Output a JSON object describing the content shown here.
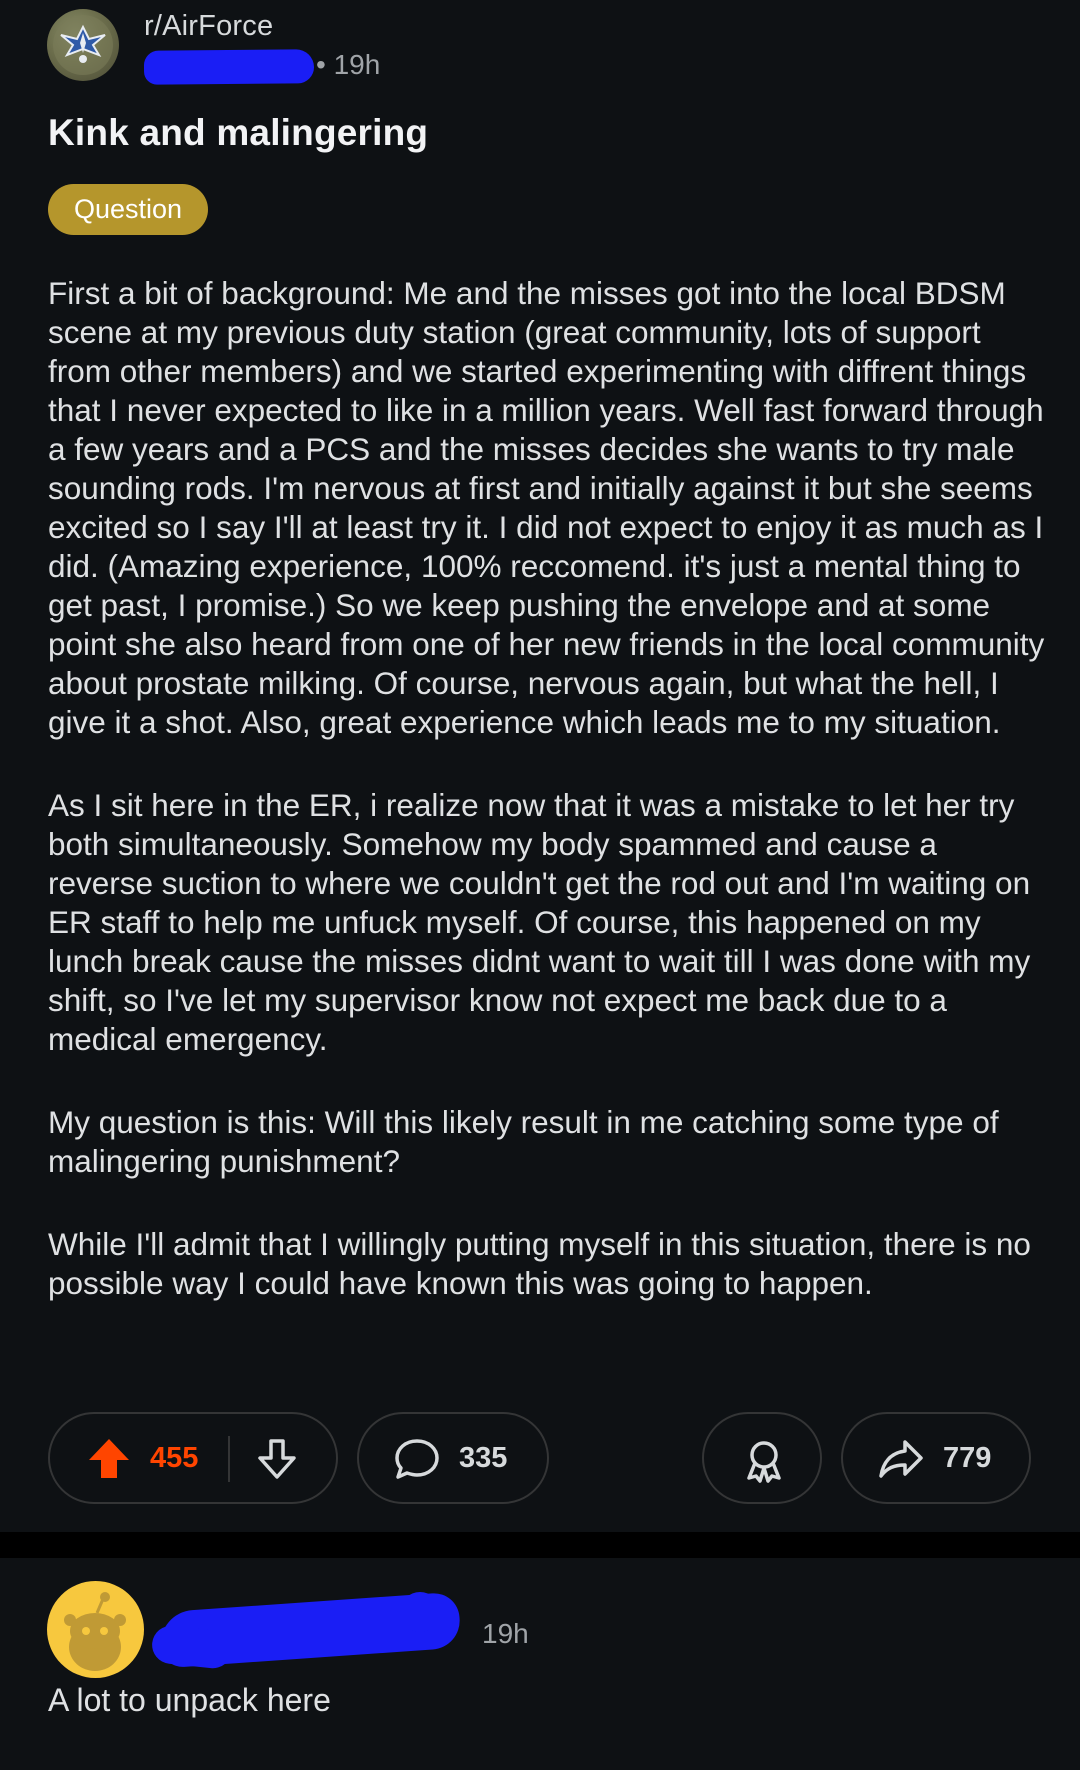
{
  "colors": {
    "background": "#0e1114",
    "separator": "#000000",
    "flair_bg": "#b5962c",
    "upvote_active": "#ff4500",
    "redaction": "#1a1ef5",
    "snoo_bg": "#f7c83e"
  },
  "post": {
    "community": "r/AirForce",
    "community_icon": "air-force-emblem-icon",
    "meta_time": "• 19h",
    "title": "Kink and malingering",
    "flair": "Question",
    "body": [
      "First a bit of background: Me and the misses got into the local BDSM scene at my previous duty station (great community, lots of support from other members) and we started experimenting with diffrent things that I never expected to like in a million years. Well fast forward through a few years and a PCS and the misses decides she wants to try male sounding rods. I'm nervous at first and initially against it but she seems excited so I say I'll at least try it. I did not expect to enjoy it as much as I did. (Amazing experience, 100% reccomend. it's just a mental thing to get past, I promise.) So we keep pushing the envelope and at some point she also heard from one of her new friends in the local community about prostate milking. Of course, nervous again, but what the hell, I give it a shot. Also, great experience which leads me to my situation.",
      "As I sit here in the ER, i realize now that it was a mistake to let her try both simultaneously. Somehow my body spammed and cause a reverse suction to where we couldn't get the rod out and I'm waiting on ER staff to help me unfuck myself. Of course, this happened on my lunch break cause the misses didnt want to wait till I was done with my shift, so I've let my supervisor know not expect me back due to a medical emergency.",
      "My question is this: Will this likely result in me catching some type of malingering punishment?",
      "While I'll admit that I willingly putting myself in this situation, there is no possible way I could have known this was going to happen."
    ],
    "actions": {
      "score": "455",
      "upvote_icon": "upvote-arrow-icon",
      "downvote_icon": "downvote-arrow-icon",
      "comments": "335",
      "comment_icon": "speech-bubble-icon",
      "award_icon": "award-ribbon-icon",
      "share_icon": "share-arrow-icon",
      "shares": "779"
    }
  },
  "comment": {
    "avatar_icon": "snoo-avatar-icon",
    "time": "19h",
    "text": "A lot to unpack here"
  }
}
